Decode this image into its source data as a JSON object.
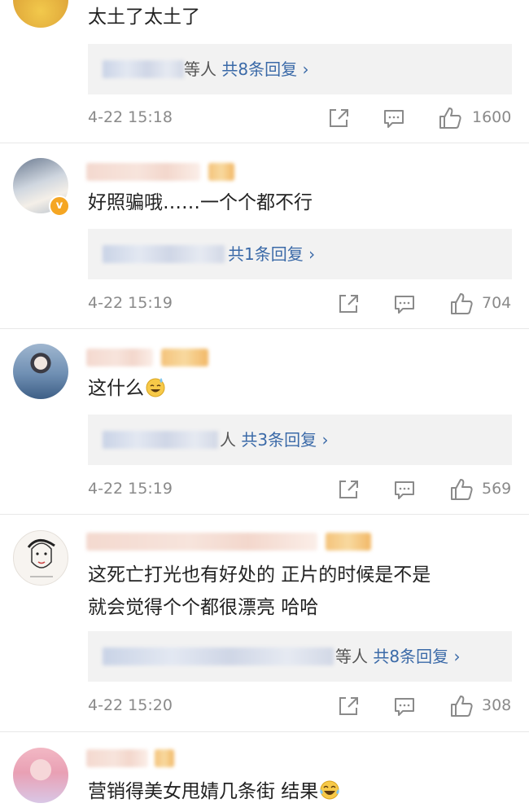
{
  "comments": [
    {
      "text": "太土了太土了",
      "reply_suffix": "等人",
      "reply_count": "共8条回复",
      "time": "4-22 15:18",
      "likes": "1600"
    },
    {
      "text": "好照骗哦……一个个都不行",
      "reply_suffix": "",
      "reply_count": "共1条回复",
      "time": "4-22 15:19",
      "likes": "704"
    },
    {
      "text": "这什么",
      "emoji": "sweat-smile-emoji",
      "reply_suffix": "人",
      "reply_count": "共3条回复",
      "time": "4-22 15:19",
      "likes": "569"
    },
    {
      "text_line1": "这死亡打光也有好处的 正片的时候是不是",
      "text_line2": "就会觉得个个都很漂亮 哈哈",
      "reply_suffix": "等人",
      "reply_count": "共8条回复",
      "time": "4-22 15:20",
      "likes": "308"
    },
    {
      "text": "营销得美女甩婧几条街 结果",
      "emoji": "laughing-crying-emoji"
    }
  ],
  "reply_chevron": "›",
  "verified_badge": "v",
  "colors": {
    "link": "#3b6aa8",
    "meta": "#8a8a8a",
    "reply_bg": "#f2f2f2",
    "badge": "#f5a623"
  },
  "icons": [
    "share-icon",
    "comment-icon",
    "like-icon",
    "chevron-right-icon"
  ]
}
